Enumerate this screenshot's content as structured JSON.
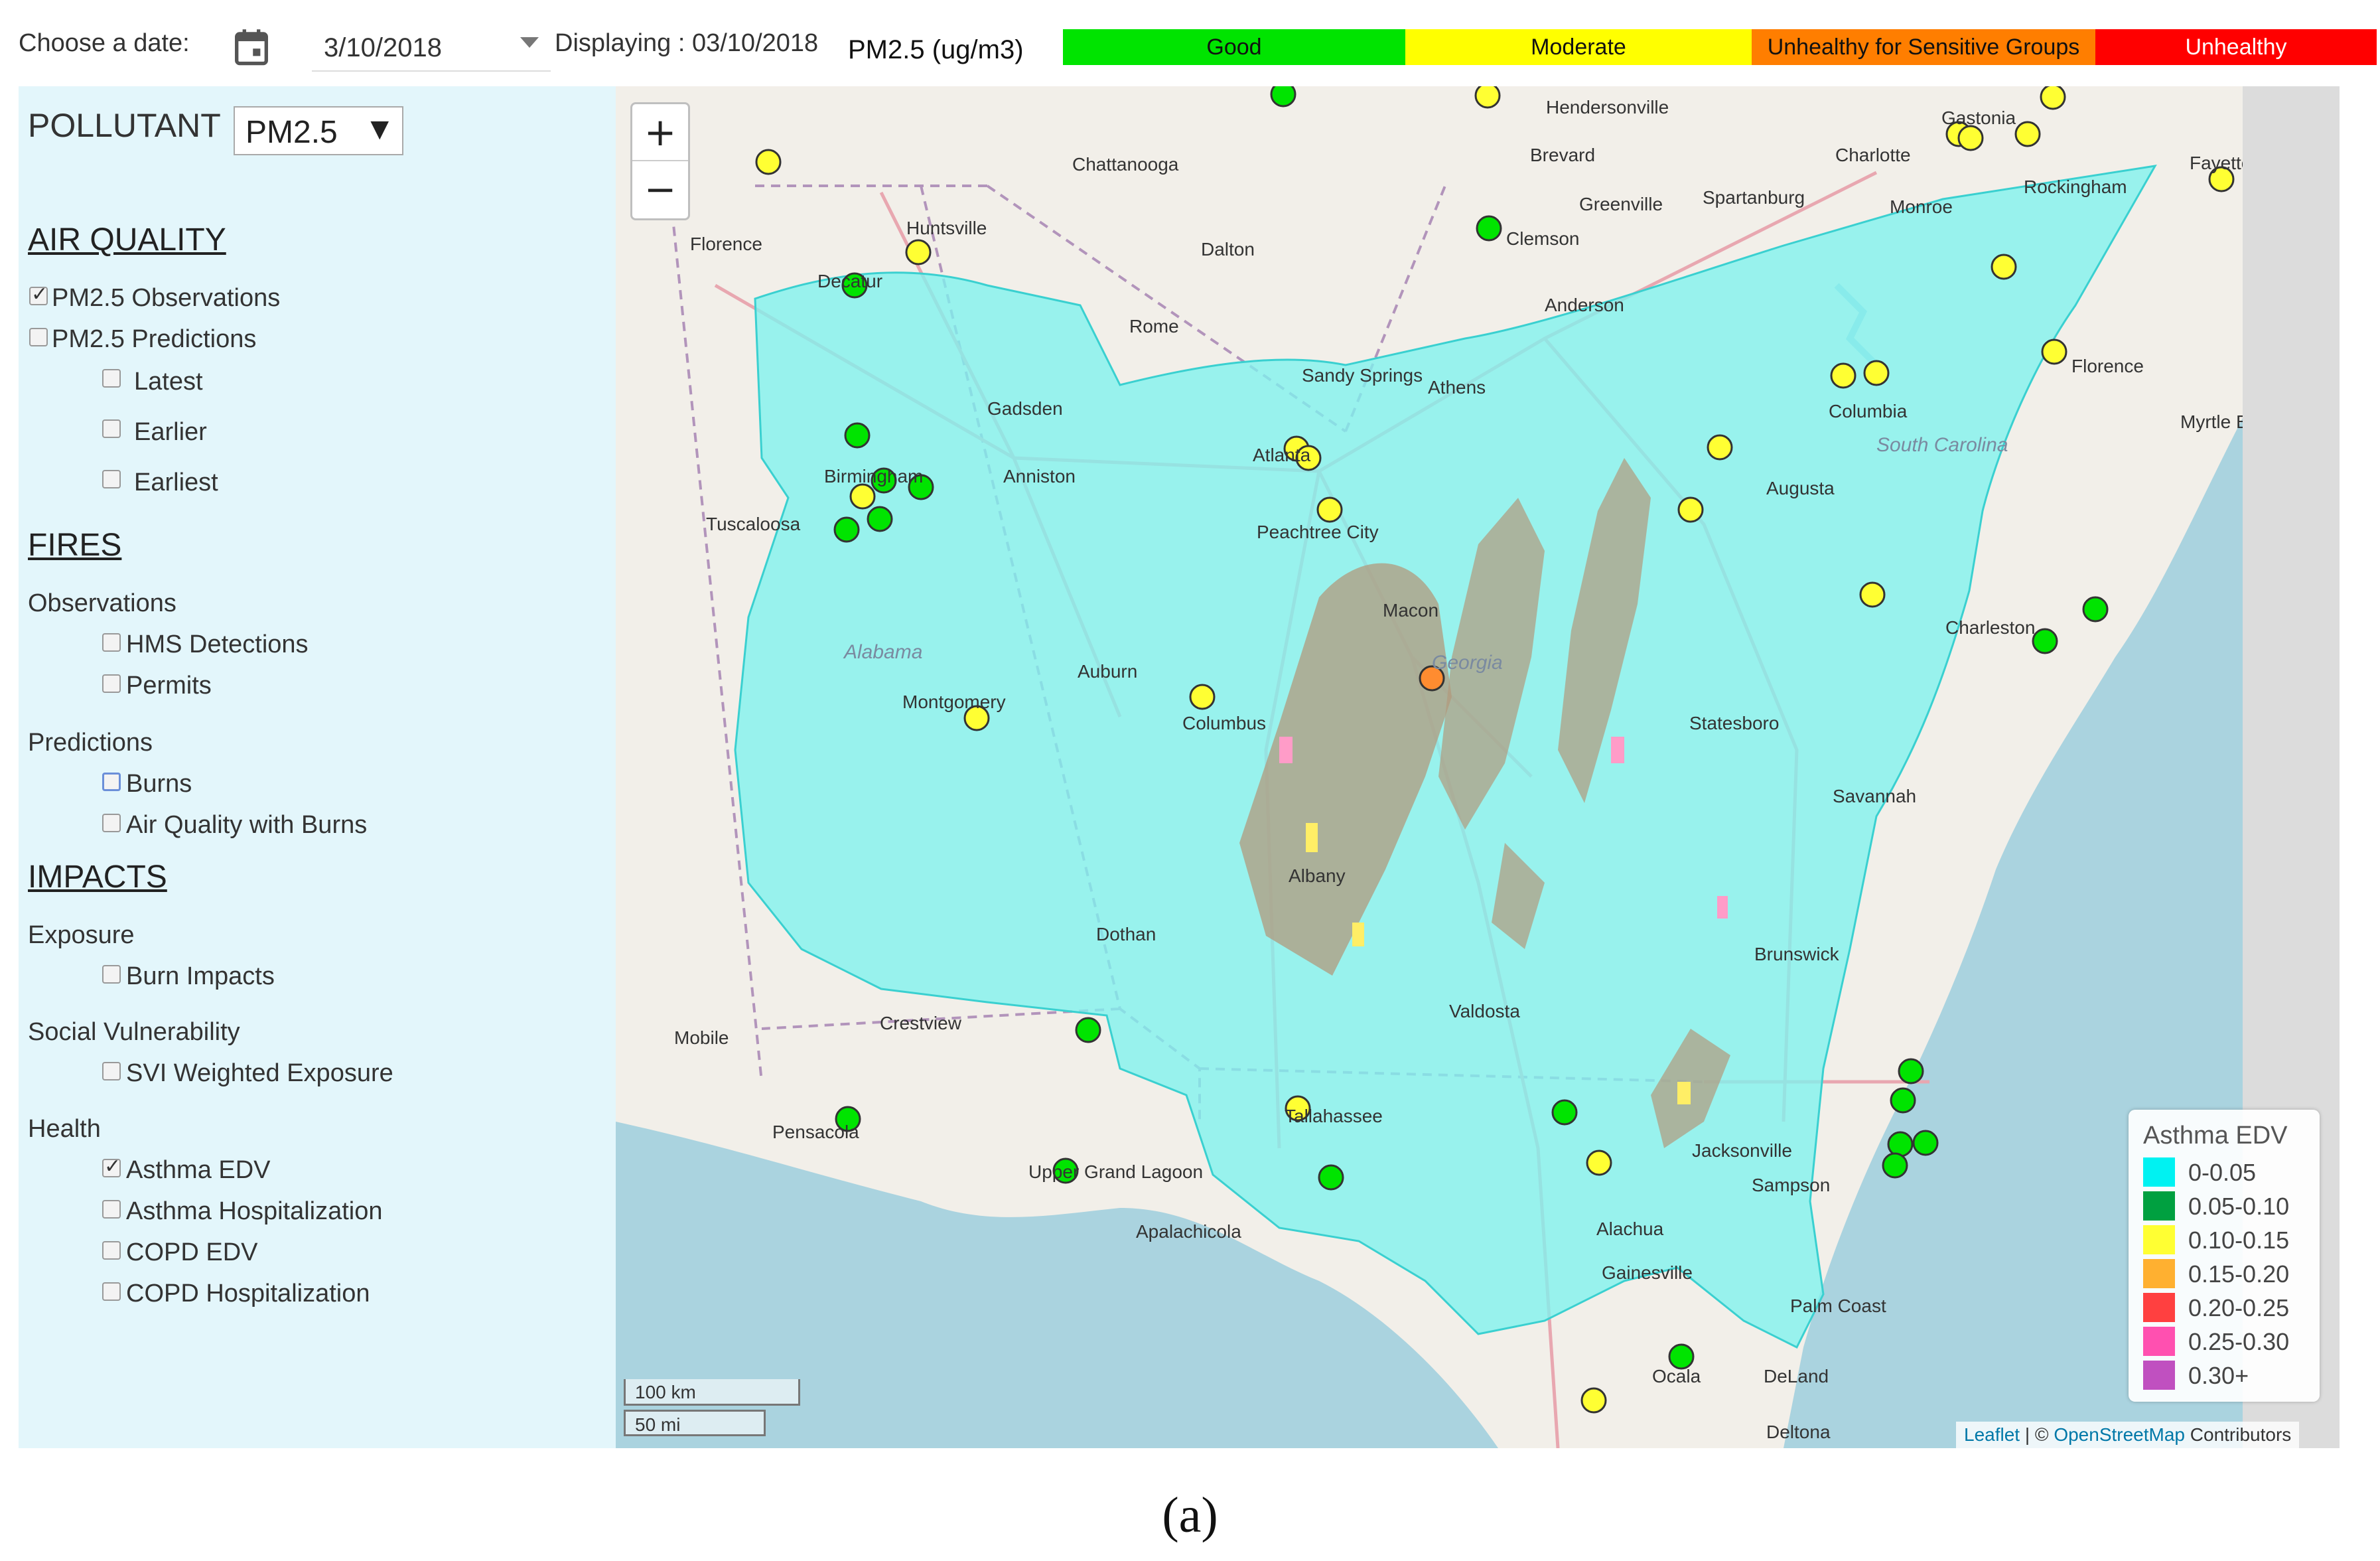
{
  "toolbar": {
    "date_label": "Choose a date:",
    "date_value": "3/10/2018",
    "displaying": "Displaying : 03/10/2018",
    "units": "PM2.5 (ug/m3)",
    "aqi_scale": [
      {
        "label": "Good",
        "color": "#00e400"
      },
      {
        "label": "Moderate",
        "color": "#ffff00"
      },
      {
        "label": "Unhealthy for Sensitive Groups",
        "color": "#ff7e00"
      },
      {
        "label": "Unhealthy",
        "color": "#ff0000"
      }
    ]
  },
  "sidebar": {
    "pollutant_label": "POLLUTANT",
    "pollutant_value": "PM2.5",
    "air_quality": {
      "heading": "AIR QUALITY",
      "obs": "PM2.5 Observations",
      "pred": "PM2.5 Predictions",
      "latest": "Latest",
      "earlier": "Earlier",
      "earliest": "Earliest"
    },
    "fires": {
      "heading": "FIRES",
      "observations": "Observations",
      "hms": "HMS Detections",
      "permits": "Permits",
      "predictions": "Predictions",
      "burns": "Burns",
      "aq_burns": "Air Quality with Burns"
    },
    "impacts": {
      "heading": "IMPACTS",
      "exposure": "Exposure",
      "burn_impacts": "Burn Impacts",
      "social": "Social Vulnerability",
      "svi": "SVI Weighted Exposure",
      "health": "Health",
      "asthma_edv": "Asthma EDV",
      "asthma_hosp": "Asthma Hospitalization",
      "copd_edv": "COPD EDV",
      "copd_hosp": "COPD Hospitalization"
    }
  },
  "map": {
    "zoom_in": "+",
    "zoom_out": "−",
    "legend": {
      "title": "Asthma EDV",
      "items": [
        {
          "label": "0-0.05",
          "color": "#00f2f2"
        },
        {
          "label": "0.05-0.10",
          "color": "#00a040"
        },
        {
          "label": "0.10-0.15",
          "color": "#ffff33"
        },
        {
          "label": "0.15-0.20",
          "color": "#ffb030"
        },
        {
          "label": "0.20-0.25",
          "color": "#ff4040"
        },
        {
          "label": "0.25-0.30",
          "color": "#ff50b0"
        },
        {
          "label": "0.30+",
          "color": "#c050c0"
        }
      ]
    },
    "scale_km": "100 km",
    "scale_mi": "50 mi",
    "attribution": {
      "leaflet": "Leaflet",
      "sep": " | © ",
      "osm": "OpenStreetMap",
      "contrib": " Contributors"
    },
    "places": [
      "Hendersonville",
      "Gastonia",
      "Chattanooga",
      "Brevard",
      "Charlotte",
      "Fayettev",
      "Greenville",
      "Spartanburg",
      "Monroe",
      "Rockingham",
      "Florence",
      "Huntsville",
      "Dalton",
      "Clemson",
      "Decatur",
      "Anderson",
      "Rome",
      "Florence",
      "Sandy Springs",
      "Athens",
      "Columbia",
      "Myrtle Beach",
      "Gadsden",
      "South Carolina",
      "Atlanta",
      "Augusta",
      "Birmingham",
      "Anniston",
      "Tuscaloosa",
      "Peachtree City",
      "Macon",
      "Alabama",
      "Auburn",
      "Georgia",
      "Charleston",
      "Montgomery",
      "Columbus",
      "Statesboro",
      "Savannah",
      "Dothan",
      "Albany",
      "Brunswick",
      "Valdosta",
      "Crestview",
      "Mobile",
      "Tallahassee",
      "Pensacola",
      "Jacksonville",
      "Upper Grand Lagoon",
      "Sampson",
      "Apalachicola",
      "Alachua",
      "Gainesville",
      "Palm Coast",
      "Ocala",
      "DeLand",
      "Deltona"
    ]
  },
  "caption": "(a)"
}
